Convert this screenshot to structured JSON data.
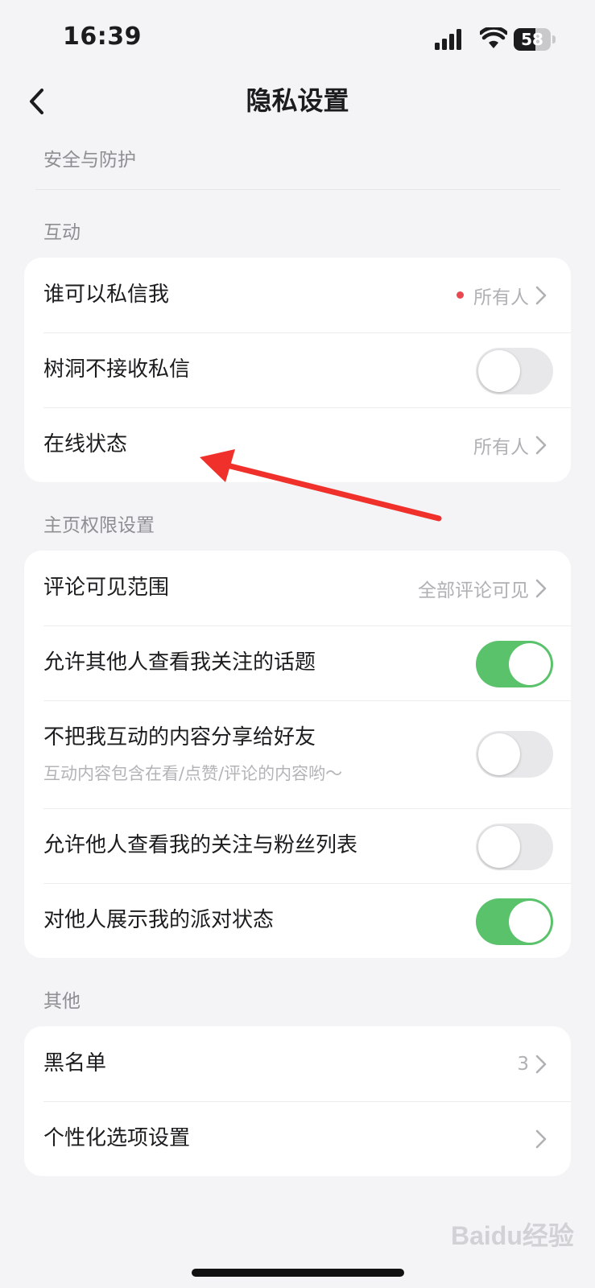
{
  "status_bar": {
    "time": "16:39",
    "battery": "58",
    "battery_fraction": 0.58
  },
  "header": {
    "title": "隐私设置"
  },
  "sections": {
    "security": {
      "title": "安全与防护"
    },
    "interaction": {
      "title": "互动",
      "items": [
        {
          "label": "谁可以私信我",
          "value": "所有人"
        },
        {
          "label": "树洞不接收私信",
          "toggle": false
        },
        {
          "label": "在线状态",
          "value": "所有人"
        }
      ]
    },
    "homepage": {
      "title": "主页权限设置",
      "items": [
        {
          "label": "评论可见范围",
          "value": "全部评论可见"
        },
        {
          "label": "允许其他人查看我关注的话题",
          "toggle": true
        },
        {
          "label": "不把我互动的内容分享给好友",
          "sublabel": "互动内容包含在看/点赞/评论的内容哟～",
          "toggle": false
        },
        {
          "label": "允许他人查看我的关注与粉丝列表",
          "toggle": false
        },
        {
          "label": "对他人展示我的派对状态",
          "toggle": true
        }
      ]
    },
    "other": {
      "title": "其他",
      "items": [
        {
          "label": "黑名单",
          "value": "3"
        },
        {
          "label": "个性化选项设置"
        }
      ]
    }
  },
  "watermark": {
    "text": "Baidu经验"
  },
  "colors": {
    "toggle_on": "#5ac26a",
    "toggle_off": "#e8e8ea",
    "annotation_arrow": "#f0302a",
    "dot": "#e8484f"
  }
}
